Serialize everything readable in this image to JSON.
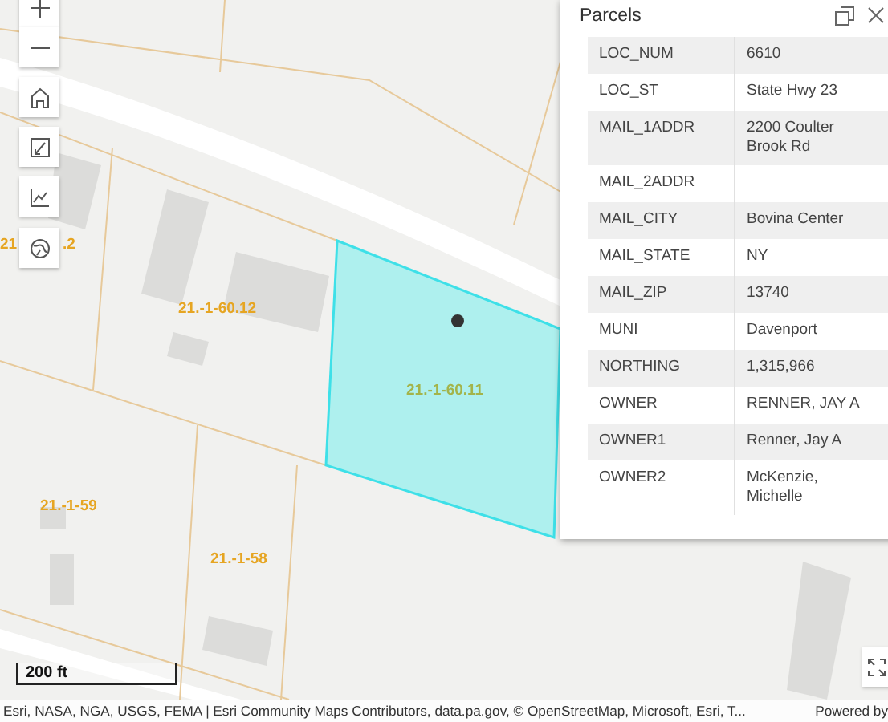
{
  "map": {
    "controls": [
      {
        "kind": "zoom_in"
      },
      {
        "kind": "zoom_out"
      },
      {
        "kind": "home"
      },
      {
        "kind": "measure"
      },
      {
        "kind": "elevation"
      },
      {
        "kind": "basemap"
      }
    ],
    "parcel_labels": [
      {
        "text": "21",
        "selected": false
      },
      {
        "text": ".2",
        "selected": false
      },
      {
        "text": "21.-1-60.12",
        "selected": false
      },
      {
        "text": "21.-1-60.11",
        "selected": true
      },
      {
        "text": "21.-1-59",
        "selected": false
      },
      {
        "text": "21.-1-58",
        "selected": false
      }
    ],
    "scale_bar": "200 ft",
    "attribution": "Esri, NASA, NGA, USGS, FEMA | Esri Community Maps Contributors, data.pa.gov, © OpenStreetMap, Microsoft, Esri, T...",
    "powered_by": "Powered by"
  },
  "popup": {
    "title": "Parcels",
    "fields": [
      {
        "name": "LOC_NUM",
        "value": "6610"
      },
      {
        "name": "LOC_ST",
        "value": "State Hwy 23"
      },
      {
        "name": "MAIL_1ADDR",
        "value": "2200 Coulter Brook Rd"
      },
      {
        "name": "MAIL_2ADDR"
      },
      {
        "name": "MAIL_CITY",
        "value": "Bovina Center"
      },
      {
        "name": "MAIL_STATE",
        "value": "NY"
      },
      {
        "name": "MAIL_ZIP",
        "value": "13740"
      },
      {
        "name": "MUNI",
        "value": "Davenport"
      },
      {
        "name": "NORTHING",
        "value": "1,315,966"
      },
      {
        "name": "OWNER",
        "value": "RENNER, JAY A"
      },
      {
        "name": "OWNER1",
        "value": "Renner, Jay A"
      },
      {
        "name": "OWNER2",
        "value": "McKenzie, Michelle"
      }
    ]
  }
}
